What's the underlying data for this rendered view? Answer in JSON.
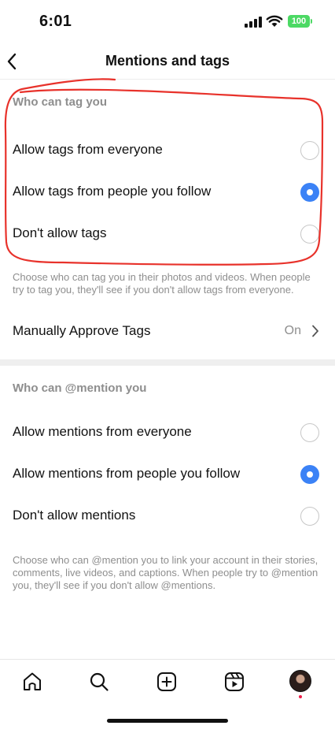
{
  "status_bar": {
    "time": "6:01",
    "battery": "100"
  },
  "header": {
    "title": "Mentions and tags",
    "back_icon": "chevron-left-icon"
  },
  "tags_section": {
    "heading": "Who can tag you",
    "options": [
      {
        "label": "Allow tags from everyone",
        "selected": false
      },
      {
        "label": "Allow tags from people you follow",
        "selected": true
      },
      {
        "label": "Don't allow tags",
        "selected": false
      }
    ],
    "help_text": "Choose who can tag you in their photos and videos. When people try to tag you, they'll see if you don't allow tags from everyone.",
    "manual_approve": {
      "label": "Manually Approve Tags",
      "value": "On"
    }
  },
  "mentions_section": {
    "heading": "Who can @mention you",
    "options": [
      {
        "label": "Allow mentions from everyone",
        "selected": false
      },
      {
        "label": "Allow mentions from people you follow",
        "selected": true
      },
      {
        "label": "Don't allow mentions",
        "selected": false
      }
    ],
    "help_text": "Choose who can @mention you to link your account in their stories, comments, live videos, and captions. When people try to @mention you, they'll see if you don't allow @mentions."
  },
  "tab_bar": {
    "tabs": [
      "home-icon",
      "search-icon",
      "create-icon",
      "reels-icon",
      "profile-avatar"
    ]
  },
  "colors": {
    "accent": "#3b82f6",
    "annotation": "#e8322b",
    "battery": "#4cd964"
  }
}
